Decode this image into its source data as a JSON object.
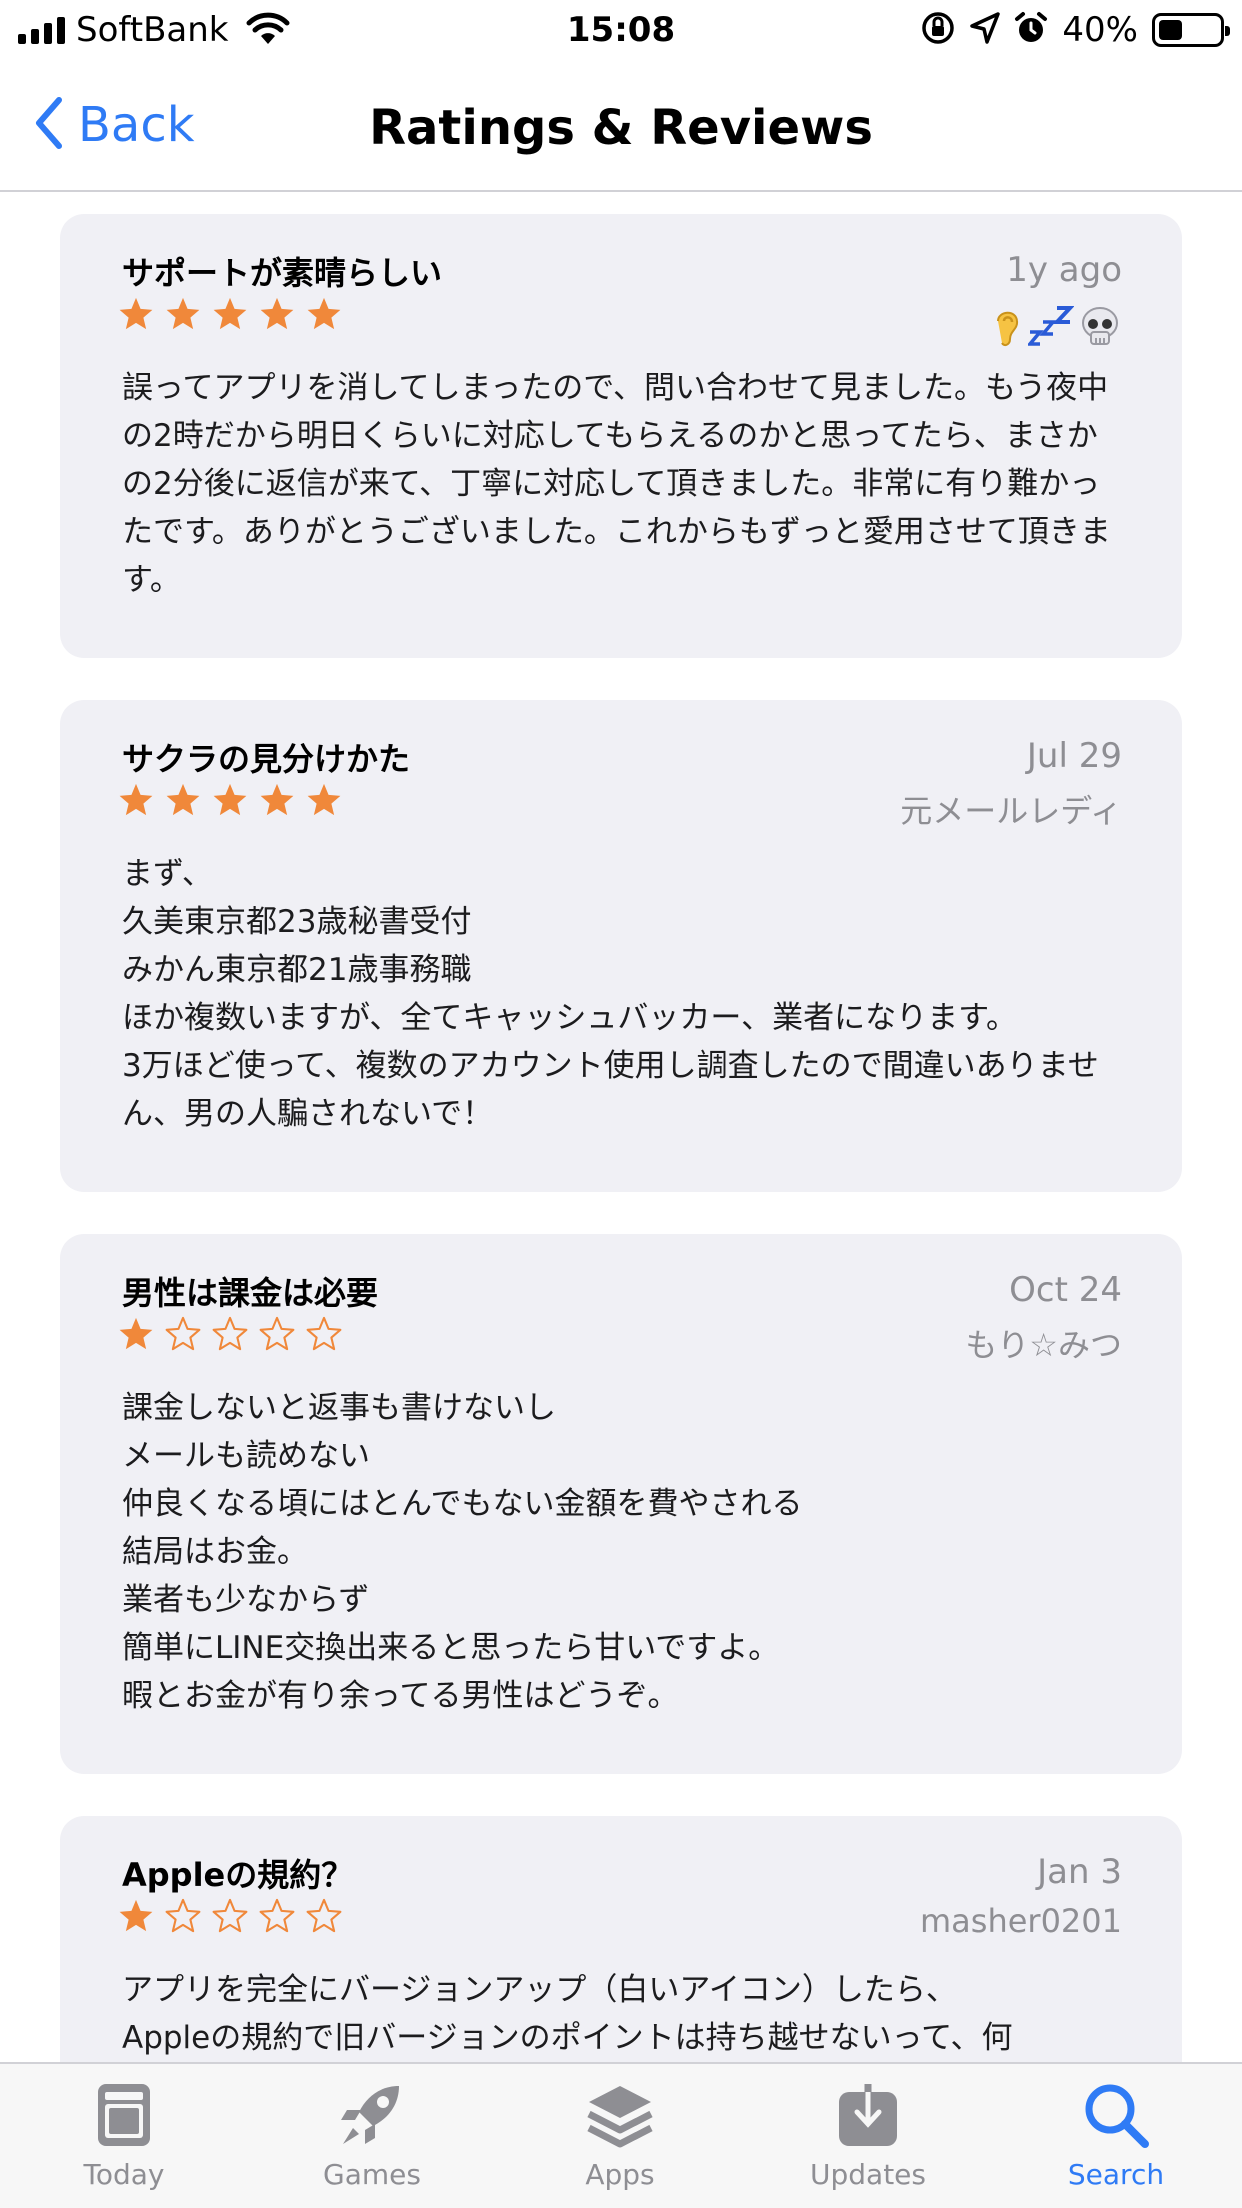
{
  "status_bar": {
    "carrier": "SoftBank",
    "time": "15:08",
    "battery_percent": "40%",
    "battery_level": 0.4
  },
  "nav": {
    "back_label": "Back",
    "title": "Ratings & Reviews"
  },
  "colors": {
    "accent": "#2f7bf5",
    "star": "#f0883a",
    "card_bg": "#f0f0f5",
    "secondary_text": "#8e8e93"
  },
  "reviews": [
    {
      "title": "サポートが素晴らしい",
      "date": "1y ago",
      "author_icons": [
        "ear-icon",
        "zzz-icon",
        "skull-icon"
      ],
      "rating": 5,
      "body": "誤ってアプリを消してしまったので、問い合わせて見ました。もう夜中の2時だから明日くらいに対応してもらえるのかと思ってたら、まさかの2分後に返信が来て、丁寧に対応して頂きました。非常に有り難かったです。ありがとうございました。これからもずっと愛用させて頂きます。"
    },
    {
      "title": "サクラの見分けかた",
      "date": "Jul 29",
      "author": "元メールレディ",
      "rating": 5,
      "body": "まず、\n久美東京都23歳秘書受付\nみかん東京都21歳事務職\nほか複数いますが、全てキャッシュバッカー、業者になります。\n3万ほど使って、複数のアカウント使用し調査したので間違いありません、男の人騙されないで！"
    },
    {
      "title": "男性は課金は必要",
      "date": "Oct 24",
      "author": "もり☆みつ",
      "rating": 1,
      "body": "課金しないと返事も書けないし\nメールも読めない\n仲良くなる頃にはとんでもない金額を費やされる\n結局はお金。\n業者も少なからず\n簡単にLINE交換出来ると思ったら甘いですよ。\n暇とお金が有り余ってる男性はどうぞ。"
    },
    {
      "title": "Appleの規約？",
      "date": "Jan 3",
      "author": "masher0201",
      "rating": 1,
      "body": "アプリを完全にバージョンアップ（白いアイコン）したら、\nAppleの規約で旧バージョンのポイントは持ち越せないって、何"
    }
  ],
  "tabs": [
    {
      "label": "Today",
      "icon": "today-icon",
      "active": false
    },
    {
      "label": "Games",
      "icon": "rocket-icon",
      "active": false
    },
    {
      "label": "Apps",
      "icon": "layers-icon",
      "active": false
    },
    {
      "label": "Updates",
      "icon": "download-icon",
      "active": false
    },
    {
      "label": "Search",
      "icon": "search-icon",
      "active": true
    }
  ]
}
